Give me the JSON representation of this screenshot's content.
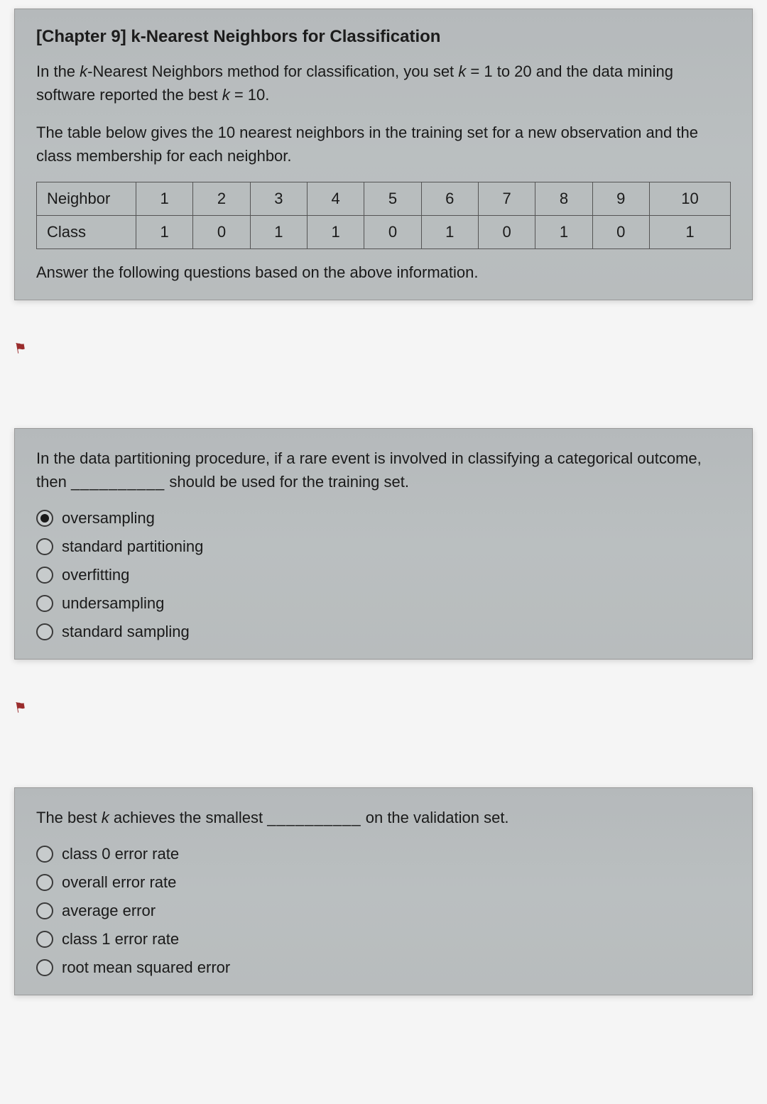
{
  "intro": {
    "title": "[Chapter 9] k-Nearest Neighbors for Classification",
    "p1_a": "In the ",
    "p1_b": "-Nearest Neighbors method for classification, you set ",
    "p1_c": " = 1 to 20 and the data mining software reported the best ",
    "p1_d": " = 10.",
    "p2": "The table below gives the 10 nearest neighbors in the training set for a new observation and the class membership for each neighbor.",
    "table": {
      "row1_label": "Neighbor",
      "row1": [
        "1",
        "2",
        "3",
        "4",
        "5",
        "6",
        "7",
        "8",
        "9",
        "10"
      ],
      "row2_label": "Class",
      "row2": [
        "1",
        "0",
        "1",
        "1",
        "0",
        "1",
        "0",
        "1",
        "0",
        "1"
      ]
    },
    "instruction": "Answer the following questions based on the above information."
  },
  "q2": {
    "text_a": "In the data partitioning procedure, if a rare event is involved in classifying a categorical outcome, then ",
    "blank": "__________",
    "text_b": " should be used for the training set.",
    "options": [
      {
        "label": "oversampling",
        "selected": true
      },
      {
        "label": "standard partitioning",
        "selected": false
      },
      {
        "label": "overfitting",
        "selected": false
      },
      {
        "label": "undersampling",
        "selected": false
      },
      {
        "label": "standard sampling",
        "selected": false
      }
    ]
  },
  "q3": {
    "text_a": "The best ",
    "text_b": " achieves the smallest ",
    "blank": "__________",
    "text_c": " on the validation set.",
    "options": [
      {
        "label": "class 0 error rate",
        "selected": false
      },
      {
        "label": "overall error rate",
        "selected": false
      },
      {
        "label": "average error",
        "selected": false
      },
      {
        "label": "class 1 error rate",
        "selected": false
      },
      {
        "label": "root mean squared error",
        "selected": false
      }
    ]
  }
}
